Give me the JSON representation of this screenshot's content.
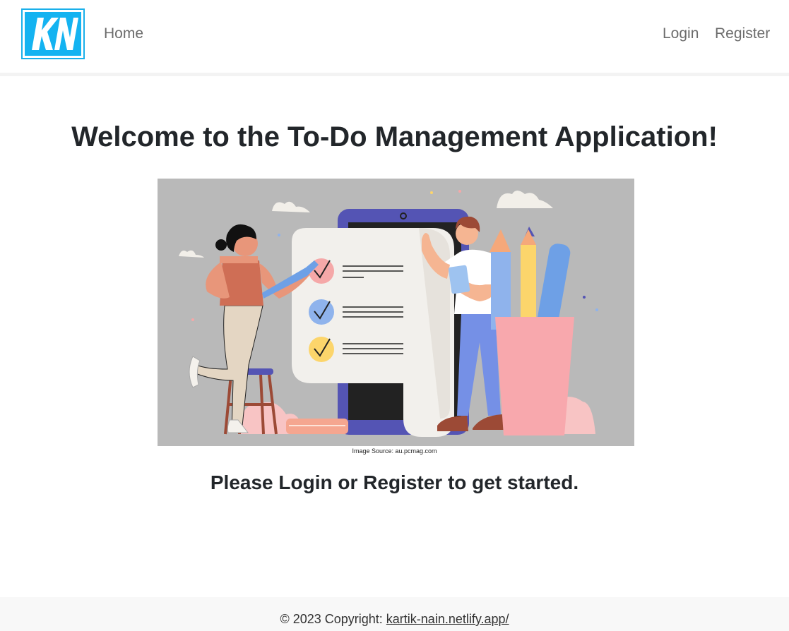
{
  "navbar": {
    "logo_text": "KN",
    "home_label": "Home",
    "login_label": "Login",
    "register_label": "Register"
  },
  "main": {
    "title": "Welcome to the To-Do Management Application!",
    "image_caption": "Image Source: au.pcmag.com",
    "cta": "Please Login or Register to get started."
  },
  "footer": {
    "copyright_prefix": "© 2023 Copyright: ",
    "link_text": "kartik-nain.netlify.app/"
  },
  "colors": {
    "brand_blue": "#14b3f1",
    "hero_background": "#b9b9b9",
    "nav_text": "#6c6c6c"
  }
}
